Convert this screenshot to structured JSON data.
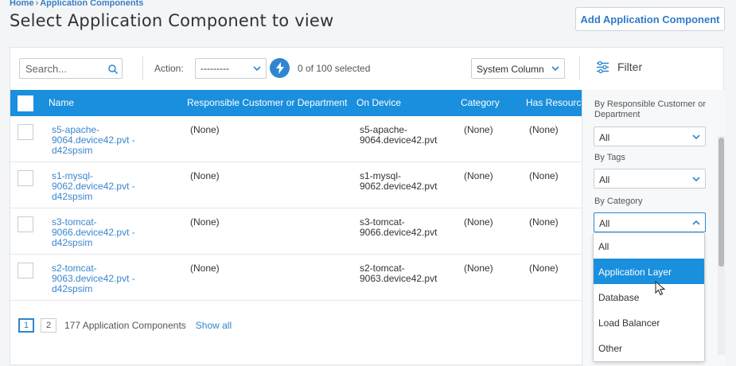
{
  "breadcrumb": {
    "home": "Home",
    "current": "Application Components"
  },
  "page_title": "Select Application Component to view",
  "add_button": "Add Application Component",
  "toolbar": {
    "search_placeholder": "Search...",
    "action_label": "Action:",
    "action_value": "---------",
    "selected_count": "0 of 100 selected",
    "system_column": "System Column",
    "filter_label": "Filter"
  },
  "table": {
    "columns": [
      "Name",
      "Responsible Customer or Department",
      "On Device",
      "Category",
      "Has Resourc"
    ],
    "rows": [
      {
        "name": [
          "s5-apache-",
          "9064.device42.pvt -",
          "d42spsim"
        ],
        "responsible": "(None)",
        "device": [
          "s5-apache-",
          "9064.device42.pvt"
        ],
        "category": "(None)",
        "has_resource": "(None)"
      },
      {
        "name": [
          "s1-mysql-",
          "9062.device42.pvt -",
          "d42spsim"
        ],
        "responsible": "(None)",
        "device": [
          "s1-mysql-",
          "9062.device42.pvt"
        ],
        "category": "(None)",
        "has_resource": "(None)"
      },
      {
        "name": [
          "s3-tomcat-",
          "9066.device42.pvt -",
          "d42spsim"
        ],
        "responsible": "(None)",
        "device": [
          "s3-tomcat-",
          "9066.device42.pvt"
        ],
        "category": "(None)",
        "has_resource": "(None)"
      },
      {
        "name": [
          "s2-tomcat-",
          "9063.device42.pvt -",
          "d42spsim"
        ],
        "responsible": "(None)",
        "device": [
          "s2-tomcat-",
          "9063.device42.pvt"
        ],
        "category": "(None)",
        "has_resource": "(None)"
      }
    ]
  },
  "pager": {
    "pages": [
      "1",
      "2"
    ],
    "active_page": "1",
    "total": "177 Application Components",
    "show_all": "Show all"
  },
  "filters": {
    "responsible_label": "By Responsible Customer or Department",
    "responsible_value": "All",
    "tags_label": "By Tags",
    "tags_value": "All",
    "category_label": "By Category",
    "category_value": "All",
    "category_options": [
      "All",
      "Application Layer",
      "Database",
      "Load Balancer",
      "Other"
    ],
    "highlighted_option": "Application Layer"
  },
  "colors": {
    "accent": "#1a8fdd",
    "link": "#3a86cf"
  }
}
